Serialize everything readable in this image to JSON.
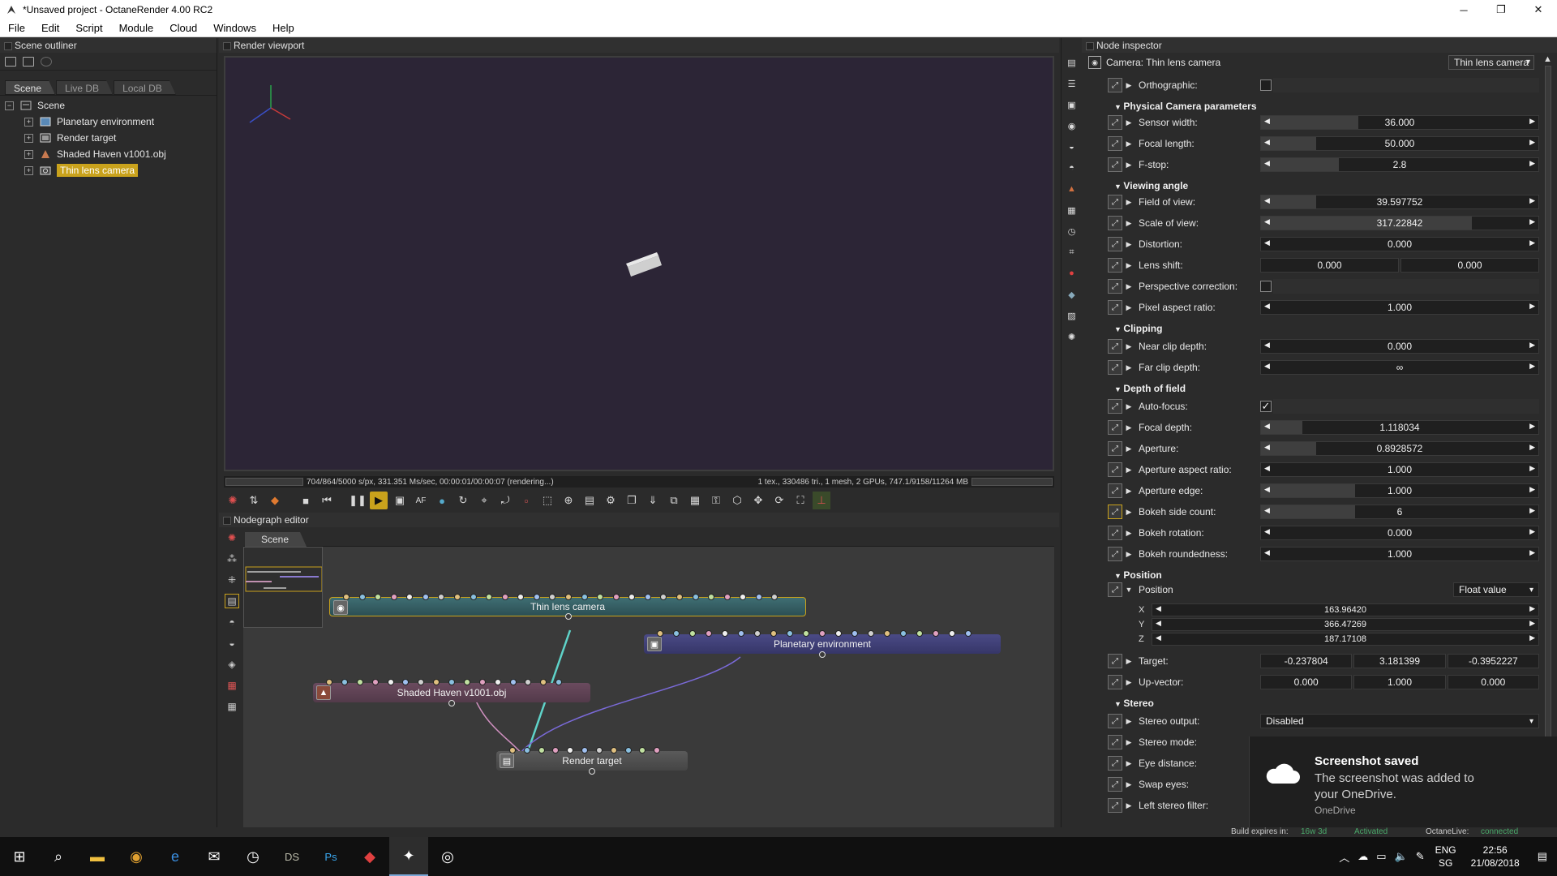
{
  "window": {
    "title": "*Unsaved project - OctaneRender 4.00 RC2",
    "controls": [
      "─",
      "❐",
      "✕"
    ]
  },
  "menu": [
    "File",
    "Edit",
    "Script",
    "Module",
    "Cloud",
    "Windows",
    "Help"
  ],
  "outliner": {
    "header": "Scene outliner",
    "tabs": [
      "Scene",
      "Live DB",
      "Local DB"
    ],
    "root": "Scene",
    "items": [
      {
        "label": "Planetary environment",
        "selected": false
      },
      {
        "label": "Render target",
        "selected": false
      },
      {
        "label": "Shaded Haven v1001.obj",
        "selected": false
      },
      {
        "label": "Thin lens camera",
        "selected": true
      }
    ]
  },
  "viewport": {
    "header": "Render viewport",
    "status_left": "704/864/5000 s/px, 331.351 Ms/sec, 00:00:01/00:00:07 (rendering...)",
    "status_right": "1 tex., 330486 tri., 1 mesh, 2 GPUs, 747.1/9158/11264 MB"
  },
  "nodegraph": {
    "header": "Nodegraph editor",
    "tab": "Scene",
    "nodes": {
      "camera": "Thin lens camera",
      "environment": "Planetary environment",
      "mesh": "Shaded Haven v1001.obj",
      "target": "Render target"
    }
  },
  "inspector": {
    "header": "Node inspector",
    "camera_label": "Camera: Thin lens camera",
    "camera_type": "Thin lens camera",
    "orthographic_label": "Orthographic:",
    "sections": {
      "physical": "Physical Camera parameters",
      "viewing": "Viewing angle",
      "clipping": "Clipping",
      "dof": "Depth of field",
      "position": "Position",
      "stereo": "Stereo"
    },
    "params": {
      "sensor_width": {
        "label": "Sensor width:",
        "value": "36.000",
        "fill": 0.35
      },
      "focal_length": {
        "label": "Focal length:",
        "value": "50.000",
        "fill": 0.2
      },
      "fstop": {
        "label": "F-stop:",
        "value": "2.8",
        "fill": 0.28
      },
      "fov": {
        "label": "Field of view:",
        "value": "39.597752",
        "fill": 0.2
      },
      "scale_of_view": {
        "label": "Scale of view:",
        "value": "317.22842",
        "fill": 0.76
      },
      "distortion": {
        "label": "Distortion:",
        "value": "0.000",
        "fill": 0
      },
      "lens_shift": {
        "label": "Lens shift:",
        "v1": "0.000",
        "v2": "0.000"
      },
      "perspective_correction": {
        "label": "Perspective correction:"
      },
      "pixel_aspect": {
        "label": "Pixel aspect ratio:",
        "value": "1.000",
        "fill": 0
      },
      "near_clip": {
        "label": "Near clip depth:",
        "value": "0.000",
        "fill": 0
      },
      "far_clip": {
        "label": "Far clip depth:",
        "value": "∞",
        "fill": 0
      },
      "autofocus": {
        "label": "Auto-focus:",
        "checked": "✓"
      },
      "focal_depth": {
        "label": "Focal depth:",
        "value": "1.118034",
        "fill": 0.15
      },
      "aperture": {
        "label": "Aperture:",
        "value": "0.8928572",
        "fill": 0.2
      },
      "aperture_aspect": {
        "label": "Aperture aspect ratio:",
        "value": "1.000",
        "fill": 0
      },
      "aperture_edge": {
        "label": "Aperture edge:",
        "value": "1.000",
        "fill": 0.34
      },
      "bokeh_side": {
        "label": "Bokeh side count:",
        "value": "6",
        "fill": 0.34
      },
      "bokeh_rotation": {
        "label": "Bokeh rotation:",
        "value": "0.000",
        "fill": 0
      },
      "bokeh_round": {
        "label": "Bokeh roundedness:",
        "value": "1.000",
        "fill": 0
      },
      "position": {
        "label": "Position",
        "mode": "Float value",
        "x": "163.96420",
        "y": "366.47269",
        "z": "187.17108"
      },
      "target": {
        "label": "Target:",
        "v1": "-0.237804",
        "v2": "3.181399",
        "v3": "-0.3952227"
      },
      "upvector": {
        "label": "Up-vector:",
        "v1": "0.000",
        "v2": "1.000",
        "v3": "0.000"
      },
      "stereo_output": {
        "label": "Stereo output:",
        "value": "Disabled"
      },
      "stereo_mode": {
        "label": "Stereo mode:"
      },
      "eye_distance": {
        "label": "Eye distance:"
      },
      "swap_eyes": {
        "label": "Swap eyes:"
      },
      "left_filter": {
        "label": "Left stereo filter:"
      }
    },
    "axes": {
      "x": "X",
      "y": "Y",
      "z": "Z"
    }
  },
  "toast": {
    "title": "Screenshot saved",
    "body": "The screenshot was added to your OneDrive.",
    "source": "OneDrive"
  },
  "octane_status": {
    "build": "Build expires in:",
    "build_val": "16w 3d",
    "activated": "Activated",
    "live": "OctaneLive:",
    "live_val": "connected"
  },
  "taskbar": {
    "apps": [
      "start",
      "search",
      "explorer",
      "chrome",
      "edge",
      "mail",
      "app",
      "DS",
      "Ps",
      "app2",
      "octane",
      "octane2"
    ],
    "lang1": "ENG",
    "lang2": "SG",
    "time": "22:56",
    "date": "21/08/2018"
  }
}
